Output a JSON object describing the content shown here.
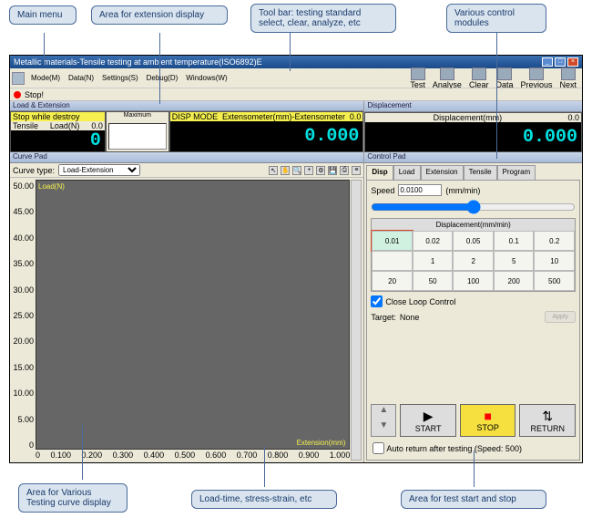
{
  "callouts": {
    "main_menu": "Main menu",
    "ext_display": "Area for extension display",
    "toolbar": "Tool bar: testing standard select, clear, analyze, etc",
    "modules": "Various control modules",
    "curve_area": "Area for Various Testing curve display",
    "load_time": "Load-time, stress-strain, etc",
    "test_start": "Area for test start and stop"
  },
  "title": "Metallic materials-Tensile testing at ambient temperature(ISO6892)E",
  "menu": [
    "Mode(M)",
    "Data(N)",
    "Settings(S)",
    "Debug(D)",
    "Windows(W)"
  ],
  "toolbar_btns": [
    "Test",
    "Analyse",
    "Clear",
    "Data",
    "Previous",
    "Next"
  ],
  "stop_label": "Stop!",
  "panel_headers": {
    "load_ext": "Load & Extension",
    "disp": "Displacement"
  },
  "cells": {
    "stop_destroy": "Stop while destroy",
    "tensile": "Tensile",
    "load_n": "Load(N)",
    "zero1": "0.0",
    "disp_mode": "DISP MODE",
    "extenso": "Extensometer(mm)-Extensometer",
    "zero2": "0.0",
    "maximum": "Maximum",
    "val0": "0",
    "val0000": "0.000",
    "disp_mm": "Displacement(mm)",
    "zero3": "0.0"
  },
  "curve": {
    "pad": "Curve Pad",
    "type_lbl": "Curve type:",
    "type_val": "Load-Extension",
    "ylabel": "Load(N)",
    "xlabel": "Extension(mm)",
    "yticks": [
      "50.00",
      "45.00",
      "40.00",
      "35.00",
      "30.00",
      "25.00",
      "20.00",
      "15.00",
      "10.00",
      "5.00",
      "0"
    ],
    "xticks": [
      "0",
      "0.100",
      "0.200",
      "0.300",
      "0.400",
      "0.500",
      "0.600",
      "0.700",
      "0.800",
      "0.900",
      "1.000"
    ]
  },
  "ctrl": {
    "pad": "Control Pad",
    "tabs": [
      "Disp",
      "Load",
      "Extension",
      "Tensile",
      "Program"
    ],
    "speed_lbl": "Speed",
    "speed_val": "0.0100",
    "speed_unit": "(mm/min)",
    "grid_h": "Displacement(mm/min)",
    "grid": [
      "0.01",
      "0.02",
      "0.05",
      "0.1",
      "0.2",
      "1",
      "2",
      "5",
      "10",
      "20",
      "50",
      "100",
      "200",
      "500"
    ],
    "check": "Close Loop Control",
    "target_lbl": "Target:",
    "target_val": "None",
    "apply": "Apply",
    "start": "START",
    "stop": "STOP",
    "return": "RETURN",
    "auto": "Auto return after testing (Speed: 500)"
  }
}
